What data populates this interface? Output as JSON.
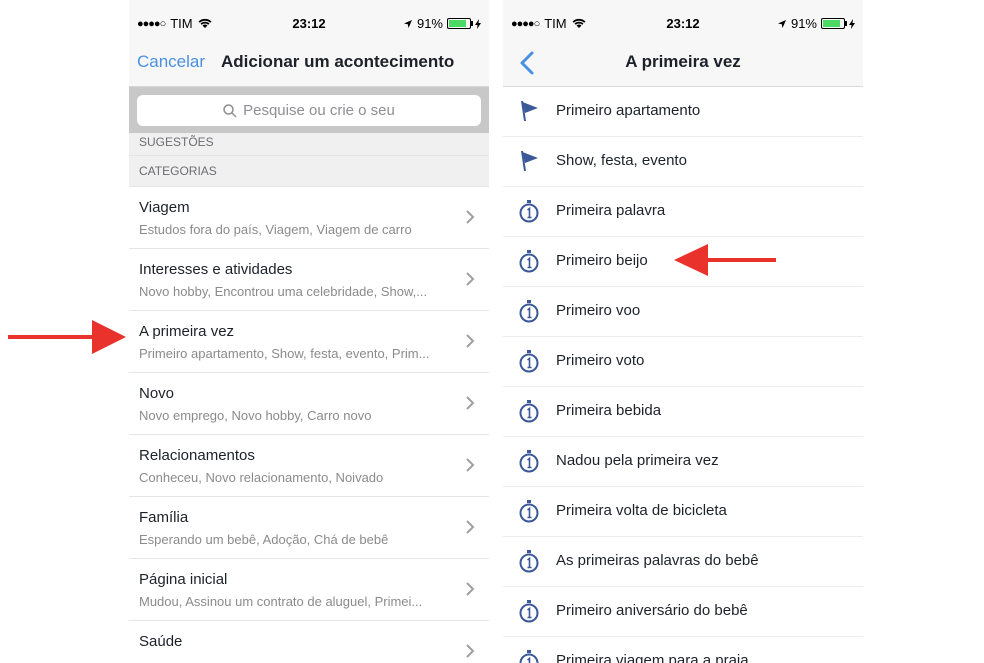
{
  "status": {
    "carrier": "TIM",
    "time": "23:12",
    "battery": "91%",
    "battery_level": 0.91
  },
  "left": {
    "cancel": "Cancelar",
    "title": "Adicionar um acontecimento",
    "search_placeholder": "Pesquise ou crie o seu",
    "sec_suggestions": "SUGESTÕES",
    "sec_categories": "CATEGORIAS",
    "categories": [
      {
        "title": "Viagem",
        "subtitle": "Estudos fora do país, Viagem, Viagem de carro"
      },
      {
        "title": "Interesses e atividades",
        "subtitle": "Novo hobby, Encontrou uma celebridade, Show,..."
      },
      {
        "title": "A primeira vez",
        "subtitle": "Primeiro apartamento, Show, festa, evento, Prim..."
      },
      {
        "title": "Novo",
        "subtitle": "Novo emprego, Novo hobby, Carro novo"
      },
      {
        "title": "Relacionamentos",
        "subtitle": "Conheceu, Novo relacionamento, Noivado"
      },
      {
        "title": "Família",
        "subtitle": "Esperando um bebê, Adoção, Chá de bebê"
      },
      {
        "title": "Página inicial",
        "subtitle": "Mudou, Assinou um contrato de aluguel, Primei..."
      },
      {
        "title": "Saúde",
        "subtitle": ""
      }
    ]
  },
  "right": {
    "title": "A primeira vez",
    "items": [
      {
        "label": "Primeiro apartamento",
        "icon": "flag-icon"
      },
      {
        "label": "Show, festa, evento",
        "icon": "flag-icon"
      },
      {
        "label": "Primeira palavra",
        "icon": "stopwatch-icon"
      },
      {
        "label": "Primeiro beijo",
        "icon": "stopwatch-icon"
      },
      {
        "label": "Primeiro voo",
        "icon": "stopwatch-icon"
      },
      {
        "label": "Primeiro voto",
        "icon": "stopwatch-icon"
      },
      {
        "label": "Primeira bebida",
        "icon": "stopwatch-icon"
      },
      {
        "label": "Nadou pela primeira vez",
        "icon": "stopwatch-icon"
      },
      {
        "label": "Primeira volta de bicicleta",
        "icon": "stopwatch-icon"
      },
      {
        "label": "As primeiras palavras do bebê",
        "icon": "stopwatch-icon"
      },
      {
        "label": "Primeiro aniversário do bebê",
        "icon": "stopwatch-icon"
      },
      {
        "label": "Primeira viagem para a praia",
        "icon": "stopwatch-icon"
      }
    ]
  },
  "colors": {
    "link": "#4a90e2",
    "icon": "#3b5998",
    "arrow": "#e8322b"
  }
}
